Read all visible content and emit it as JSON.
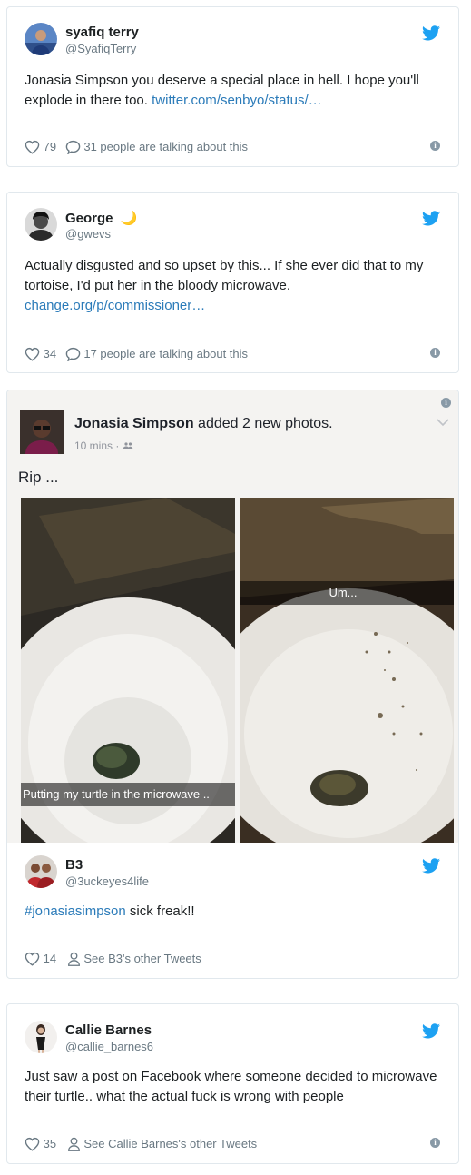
{
  "tweets": [
    {
      "name": "syafiq terry",
      "handle": "@SyafiqTerry",
      "text": "Jonasia Simpson you deserve a special place in hell. I hope you'll explode in there too.",
      "link": "twitter.com/senbyo/status/…",
      "likes": "79",
      "talking": "31 people are talking about this"
    },
    {
      "name": "George",
      "emoji": "🌙",
      "handle": "@gwevs",
      "text": "Actually disgusted and so upset by this... If she ever did that to my tortoise, I'd put her in the bloody microwave.",
      "link": "change.org/p/commissioner…",
      "likes": "34",
      "talking": "17 people are talking about this"
    },
    {
      "name": "B3",
      "handle": "@3uckeyes4life",
      "hashtag": "#jonasiasimpson",
      "text": "sick freak!!",
      "likes": "14",
      "other": "See B3's other Tweets"
    },
    {
      "name": "Callie Barnes",
      "handle": "@callie_barnes6",
      "text": "Just saw a post on Facebook where someone decided to microwave their turtle.. what the actual fuck is wrong with people",
      "likes": "35",
      "other": "See Callie Barnes's other Tweets"
    }
  ],
  "facebook_post": {
    "author": "Jonasia Simpson",
    "action": "added 2 new photos.",
    "time": "10 mins",
    "caption": "Rip ...",
    "photo_left_caption": "Putting my turtle in the microwave ..",
    "photo_right_caption": "Um..."
  },
  "colors": {
    "link": "#2b7bb9",
    "twitter_blue": "#1da1f2",
    "muted": "#697882",
    "border": "#e1e8ed"
  },
  "icons": [
    "twitter-bird-icon",
    "heart-icon",
    "reply-bubble-icon",
    "person-icon",
    "info-icon",
    "chevron-down-icon",
    "friends-icon"
  ]
}
